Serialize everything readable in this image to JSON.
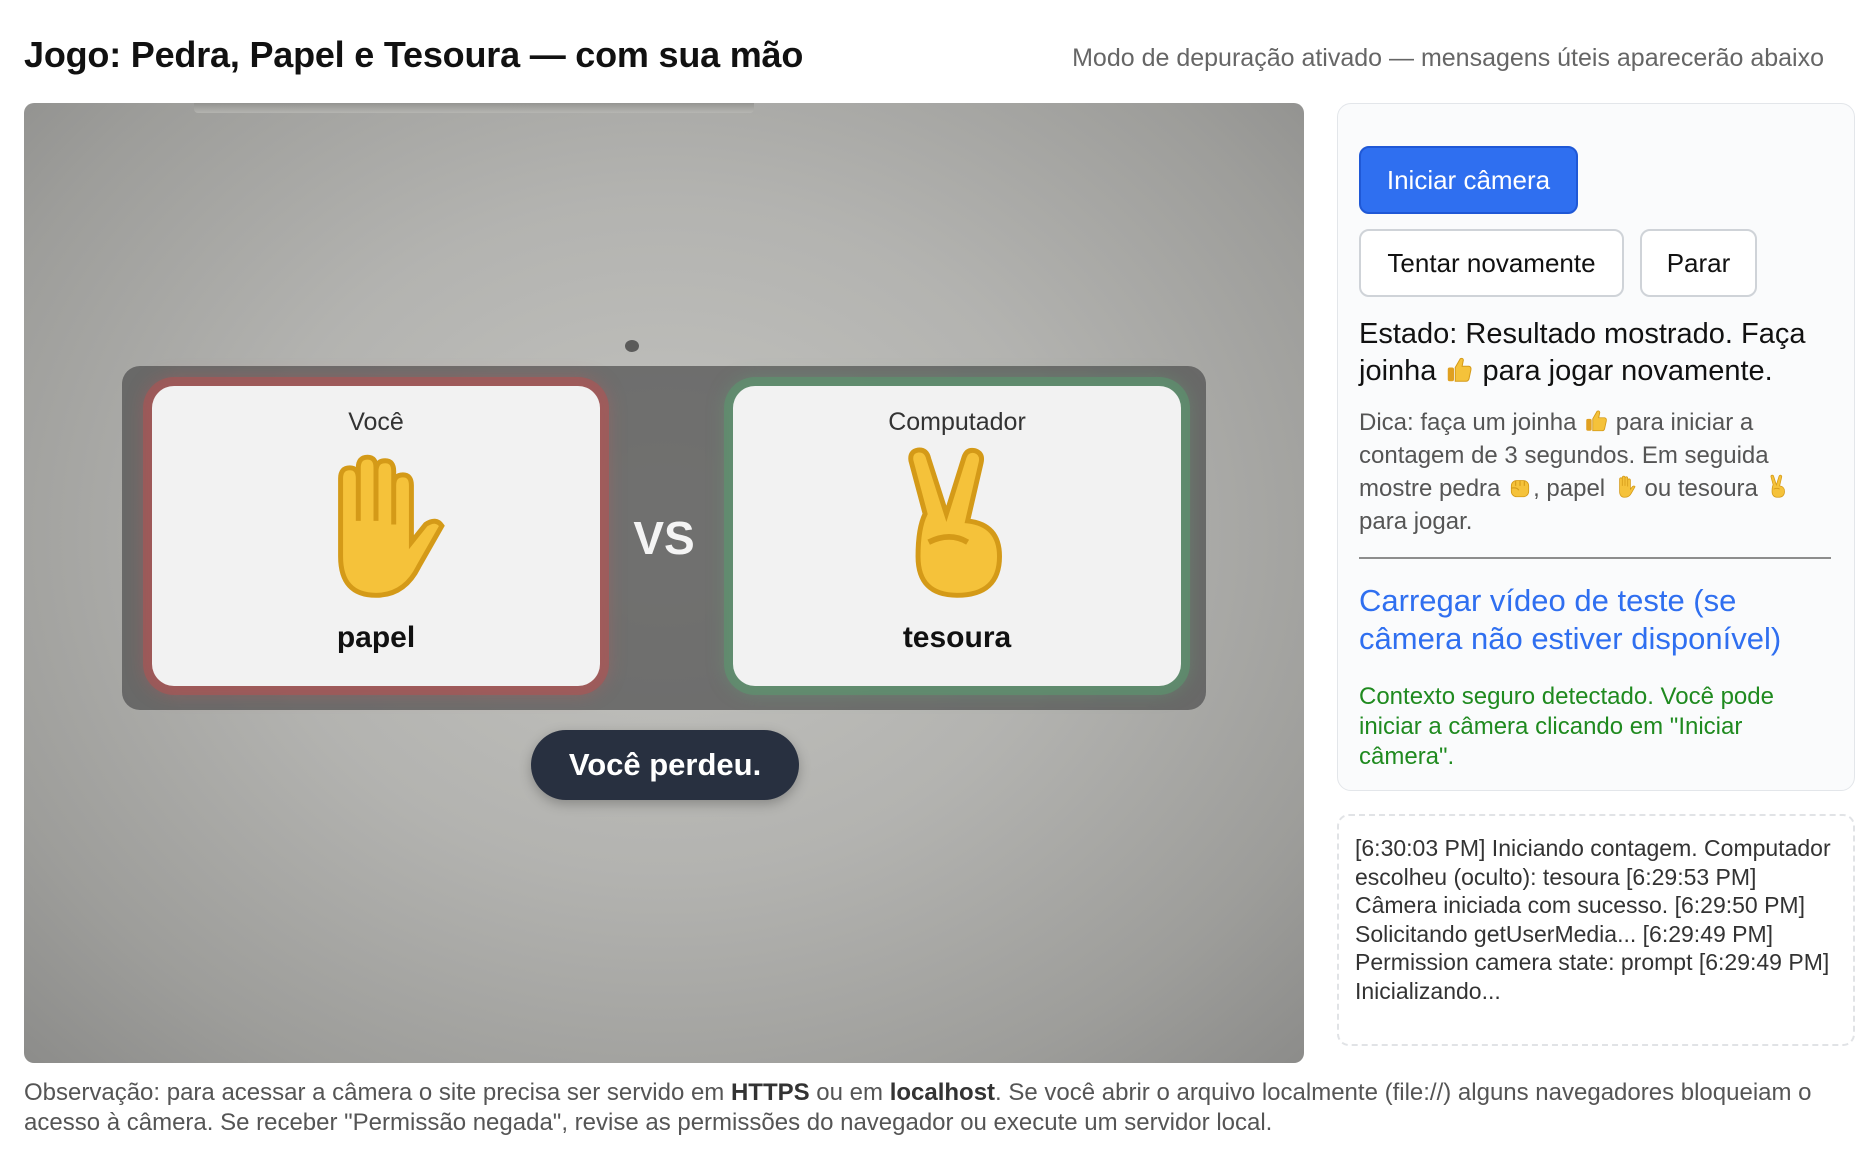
{
  "header": {
    "title": "Jogo: Pedra, Papel e Tesoura — com sua mão",
    "debug_note": "Modo de depuração ativado — mensagens úteis aparecerão abaixo"
  },
  "game": {
    "player_label": "Você",
    "player_choice": "papel",
    "player_hand_icon": "raised-hand-icon",
    "computer_label": "Computador",
    "computer_choice": "tesoura",
    "computer_hand_icon": "victory-hand-icon",
    "vs_label": "VS",
    "result": "Você perdeu."
  },
  "controls": {
    "start_camera_label": "Iniciar câmera",
    "retry_label": "Tentar novamente",
    "stop_label": "Parar"
  },
  "status": {
    "state_prefix": "Estado: Resultado mostrado. Faça joinha",
    "state_suffix": "para jogar novamente.",
    "hint_part1": "Dica: faça um joinha",
    "hint_part2": "para iniciar a contagem de 3 segundos. Em seguida mostre pedra",
    "hint_part3": ", papel",
    "hint_part4": "ou tesoura",
    "hint_part5": "para jogar.",
    "test_video_link": "Carregar vídeo de teste (se câmera não estiver disponível)",
    "secure_context_msg": "Contexto seguro detectado. Você pode iniciar a câmera clicando em \"Iniciar câmera\"."
  },
  "log": {
    "text": "[6:30:03 PM] Iniciando contagem. Computador escolheu (oculto): tesoura [6:29:53 PM] Câmera iniciada com sucesso. [6:29:50 PM] Solicitando getUserMedia... [6:29:49 PM] Permission camera state: prompt [6:29:49 PM] Inicializando..."
  },
  "footer": {
    "part1": "Observação: para acessar a câmera o site precisa ser servido em ",
    "https": "HTTPS",
    "part2": " ou em ",
    "localhost": "localhost",
    "part3": ". Se você abrir o arquivo localmente (file://) alguns navegadores bloqueiam o acesso à câmera. Se receber \"Permissão negada\", revise as permissões do navegador ou execute um servidor local."
  },
  "colors": {
    "accent": "#2f6ff0",
    "success": "#1f8a1f",
    "result_pill": "#283040",
    "lose_glow": "#b45050",
    "win_glow": "#5a966e",
    "emoji_yellow": "#f5c23a"
  }
}
